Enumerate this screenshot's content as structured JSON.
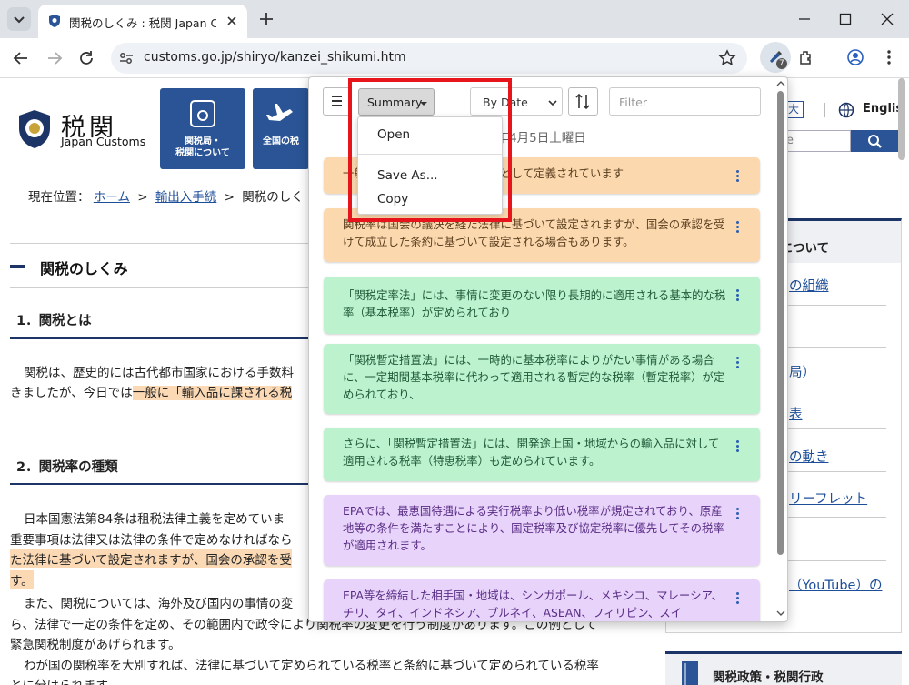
{
  "browser": {
    "tab_title": "関税のしくみ : 税関 Japan Customs",
    "url": "customs.go.jp/shiryo/kanzei_shikumi.htm",
    "extension_badge": "7"
  },
  "site": {
    "logo_jp": "税関",
    "logo_en": "Japan Customs",
    "nav1_line1": "関税局・",
    "nav1_line2": "税関について",
    "nav2": "全国の税",
    "font_size_btn": "大",
    "lang_link": "Englis",
    "search_partial": "e",
    "breadcrumb_prefix": "現在位置：",
    "breadcrumb_home": "ホーム",
    "breadcrumb_sep1": ">",
    "breadcrumb_trade": "輸出入手続",
    "breadcrumb_sep2": ">",
    "breadcrumb_current": "関税のしく",
    "page_heading": "関税のしくみ",
    "section1": "1．関税とは",
    "s1_line1": "関税は、歴史的には古代都市国家における手数料",
    "s1_line2a": "きましたが、今日では",
    "s1_line2b": "一般に「輸入品に課される税",
    "section2": "2．関税率の種類",
    "s2_l1": "日本国憲法第84条は租税法律主義を定めていま",
    "s2_l2": "重要事項は法律又は法律の条件で定めなければなら",
    "s2_l3": "た法律に基づいて設定されますが、国会の承認を受",
    "s2_l4": "す。",
    "s2_l5": "また、関税については、海外及び国内の事情の変",
    "s2_l6": "ら、法律で一定の条件を定め、その範囲内で政令により関税率の変更を行う制度があります。この例として",
    "s2_l7": "緊急関税制度があげられます。",
    "s2_l8": "わが国の関税率を大別すれば、法律に基づいて定められている税率と条約に基づいて定められている税率",
    "s2_l9": "とに分けられます。",
    "sidebar_title": "局について",
    "sidebar_links": [
      "の組織",
      "局）",
      "表",
      "の動き",
      "リーフレット",
      "（YouTube）の"
    ],
    "sidebar_bottom": "関税政策・税関行政"
  },
  "popup": {
    "summary_label": "Summary",
    "sort_label": "By Date",
    "filter_placeholder": "Filter",
    "date_text": "5年4月5日土曜日",
    "menu": {
      "open": "Open",
      "save_as": "Save As...",
      "copy": "Copy"
    },
    "cards": [
      {
        "color": "orange",
        "text": "一般に「輸入品に課される税」として定義されています"
      },
      {
        "color": "orange",
        "text": "関税率は国会の議決を経た法律に基づいて設定されますが、国会の承認を受けて成立した条約に基づいて設定される場合もあります。"
      },
      {
        "color": "green",
        "text": "「関税定率法」には、事情に変更のない限り長期的に適用される基本的な税率（基本税率）が定められており"
      },
      {
        "color": "green",
        "text": "「関税暫定措置法」には、一時的に基本税率によりがたい事情がある場合に、一定期間基本税率に代わって適用される暫定的な税率（暫定税率）が定められており、"
      },
      {
        "color": "green",
        "text": "さらに、「関税暫定措置法」には、開発途上国・地域からの輸入品に対して適用される税率（特恵税率）も定められています。"
      },
      {
        "color": "purple",
        "text": "EPAでは、最恵国待遇による実行税率より低い税率が規定されており、原産地等の条件を満たすことにより、国定税率及び協定税率に優先してその税率が適用されます。"
      },
      {
        "color": "purple",
        "text": "EPA等を締結した相手国・地域は、シンガポール、メキシコ、マレーシア、チリ、タイ、インドネシア、ブルネイ、ASEAN、フィリピン、スイ"
      }
    ]
  },
  "colors": {
    "highlight_box": "#e8141c",
    "accent_blue": "#2a5496"
  }
}
